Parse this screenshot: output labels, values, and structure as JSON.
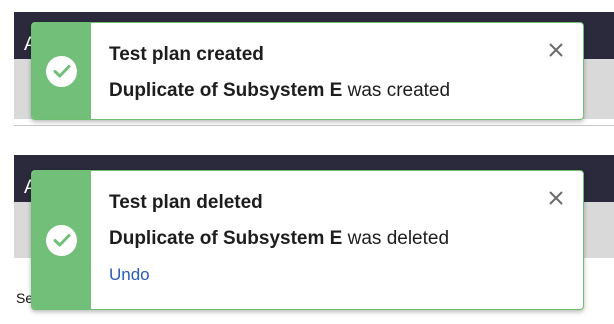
{
  "background": {
    "panel1_edge_text": "A",
    "panel2_edge_text": "A",
    "panel2_footer_text": "Se"
  },
  "toasts": [
    {
      "title": "Test plan created",
      "message_subject": "Duplicate of Subsystem E",
      "message_suffix": " was created",
      "icon": "check-icon",
      "close_icon": "close-icon"
    },
    {
      "title": "Test plan deleted",
      "message_subject": "Duplicate of Subsystem E",
      "message_suffix": " was deleted",
      "undo_label": "Undo",
      "icon": "check-icon",
      "close_icon": "close-icon"
    }
  ],
  "colors": {
    "success_stripe": "#72bf7a",
    "toast_border": "#6fbf73",
    "header_dark": "#2b2a3d",
    "link": "#2a5cb8"
  }
}
